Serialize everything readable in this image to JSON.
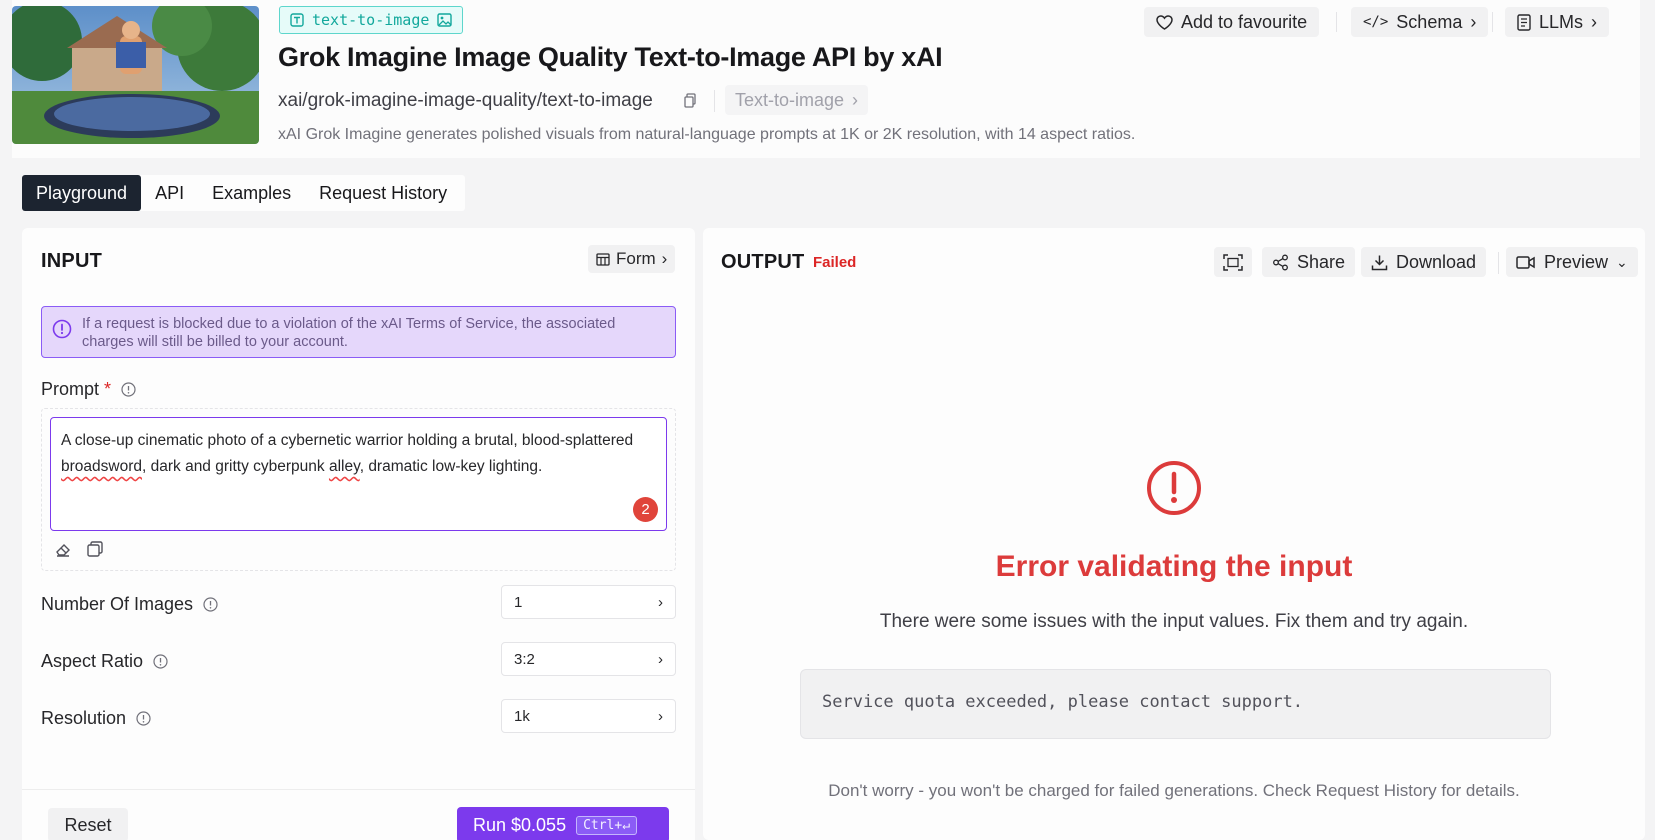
{
  "header": {
    "tag": "text-to-image",
    "title": "Grok Imagine Image Quality Text-to-Image API by xAI",
    "slug": "xai/grok-imagine-image-quality/text-to-image",
    "category": "Text-to-image",
    "description": "xAI Grok Imagine generates polished visuals from natural-language prompts at 1K or 2K resolution, with 14 aspect ratios.",
    "favourite_label": "Add to favourite",
    "schema_label": "Schema",
    "llms_label": "LLMs"
  },
  "tabs": [
    "Playground",
    "API",
    "Examples",
    "Request History"
  ],
  "input": {
    "title": "INPUT",
    "form_label": "Form",
    "alert": "If a request is blocked due to a violation of the xAI Terms of Service, the associated charges will still be billed to your account.",
    "prompt_label": "Prompt",
    "required_mark": "*",
    "prompt": {
      "part1": "A close-up cinematic photo of a cybernetic warrior holding a brutal, blood-splattered ",
      "word1": "broadsword",
      "part2": ", dark and gritty cyberpunk ",
      "word2": "alley",
      "part3": ", dramatic low-key lighting."
    },
    "error_count": "2",
    "fields": [
      {
        "label": "Number Of Images",
        "value": "1"
      },
      {
        "label": "Aspect Ratio",
        "value": "3:2"
      },
      {
        "label": "Resolution",
        "value": "1k"
      }
    ],
    "reset_label": "Reset",
    "run_label": "Run $0.055",
    "run_shortcut": "Ctrl+↵"
  },
  "output": {
    "title": "OUTPUT",
    "status": "Failed",
    "share_label": "Share",
    "download_label": "Download",
    "preview_label": "Preview",
    "error_title": "Error validating the input",
    "error_subtitle": "There were some issues with the input values. Fix them and try again.",
    "error_message": "Service quota exceeded, please contact support.",
    "error_note": "Don't worry - you won't be charged for failed generations. Check Request History for details."
  },
  "colors": {
    "accent": "#7c3aed",
    "error": "#dc3b3b",
    "tag": "#12a89c",
    "tab_active": "#1c2430"
  }
}
